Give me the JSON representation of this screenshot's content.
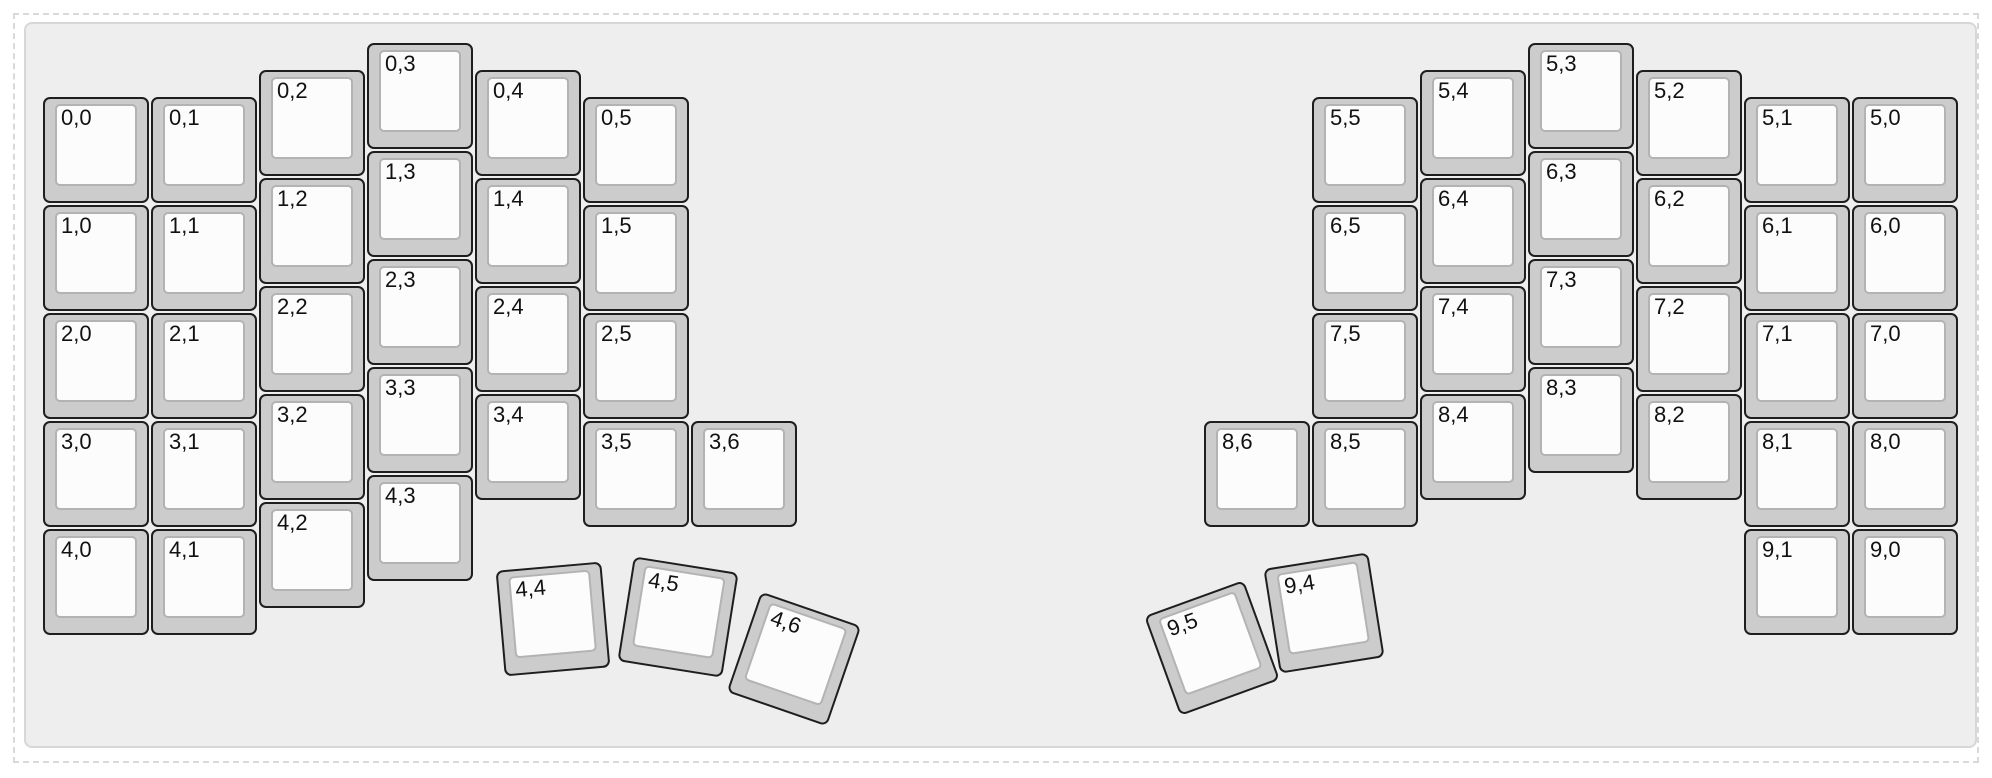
{
  "keys": [
    {
      "id": "0,0",
      "label": "0,0"
    },
    {
      "id": "0,1",
      "label": "0,1"
    },
    {
      "id": "0,2",
      "label": "0,2"
    },
    {
      "id": "0,3",
      "label": "0,3"
    },
    {
      "id": "0,4",
      "label": "0,4"
    },
    {
      "id": "0,5",
      "label": "0,5"
    },
    {
      "id": "1,0",
      "label": "1,0"
    },
    {
      "id": "1,1",
      "label": "1,1"
    },
    {
      "id": "1,2",
      "label": "1,2"
    },
    {
      "id": "1,3",
      "label": "1,3"
    },
    {
      "id": "1,4",
      "label": "1,4"
    },
    {
      "id": "1,5",
      "label": "1,5"
    },
    {
      "id": "2,0",
      "label": "2,0"
    },
    {
      "id": "2,1",
      "label": "2,1"
    },
    {
      "id": "2,2",
      "label": "2,2"
    },
    {
      "id": "2,3",
      "label": "2,3"
    },
    {
      "id": "2,4",
      "label": "2,4"
    },
    {
      "id": "2,5",
      "label": "2,5"
    },
    {
      "id": "3,0",
      "label": "3,0"
    },
    {
      "id": "3,1",
      "label": "3,1"
    },
    {
      "id": "3,2",
      "label": "3,2"
    },
    {
      "id": "3,3",
      "label": "3,3"
    },
    {
      "id": "3,4",
      "label": "3,4"
    },
    {
      "id": "3,5",
      "label": "3,5"
    },
    {
      "id": "3,6",
      "label": "3,6"
    },
    {
      "id": "4,0",
      "label": "4,0"
    },
    {
      "id": "4,1",
      "label": "4,1"
    },
    {
      "id": "4,2",
      "label": "4,2"
    },
    {
      "id": "4,3",
      "label": "4,3"
    },
    {
      "id": "4,4",
      "label": "4,4"
    },
    {
      "id": "4,5",
      "label": "4,5"
    },
    {
      "id": "4,6",
      "label": "4,6"
    },
    {
      "id": "5,5",
      "label": "5,5"
    },
    {
      "id": "5,4",
      "label": "5,4"
    },
    {
      "id": "5,3",
      "label": "5,3"
    },
    {
      "id": "5,2",
      "label": "5,2"
    },
    {
      "id": "5,1",
      "label": "5,1"
    },
    {
      "id": "5,0",
      "label": "5,0"
    },
    {
      "id": "6,5",
      "label": "6,5"
    },
    {
      "id": "6,4",
      "label": "6,4"
    },
    {
      "id": "6,3",
      "label": "6,3"
    },
    {
      "id": "6,2",
      "label": "6,2"
    },
    {
      "id": "6,1",
      "label": "6,1"
    },
    {
      "id": "6,0",
      "label": "6,0"
    },
    {
      "id": "7,5",
      "label": "7,5"
    },
    {
      "id": "7,4",
      "label": "7,4"
    },
    {
      "id": "7,3",
      "label": "7,3"
    },
    {
      "id": "7,2",
      "label": "7,2"
    },
    {
      "id": "7,1",
      "label": "7,1"
    },
    {
      "id": "7,0",
      "label": "7,0"
    },
    {
      "id": "8,6",
      "label": "8,6"
    },
    {
      "id": "8,5",
      "label": "8,5"
    },
    {
      "id": "8,4",
      "label": "8,4"
    },
    {
      "id": "8,3",
      "label": "8,3"
    },
    {
      "id": "8,2",
      "label": "8,2"
    },
    {
      "id": "8,1",
      "label": "8,1"
    },
    {
      "id": "8,0",
      "label": "8,0"
    },
    {
      "id": "9,5",
      "label": "9,5"
    },
    {
      "id": "9,4",
      "label": "9,4"
    },
    {
      "id": "9,1",
      "label": "9,1"
    },
    {
      "id": "9,0",
      "label": "9,0"
    }
  ]
}
